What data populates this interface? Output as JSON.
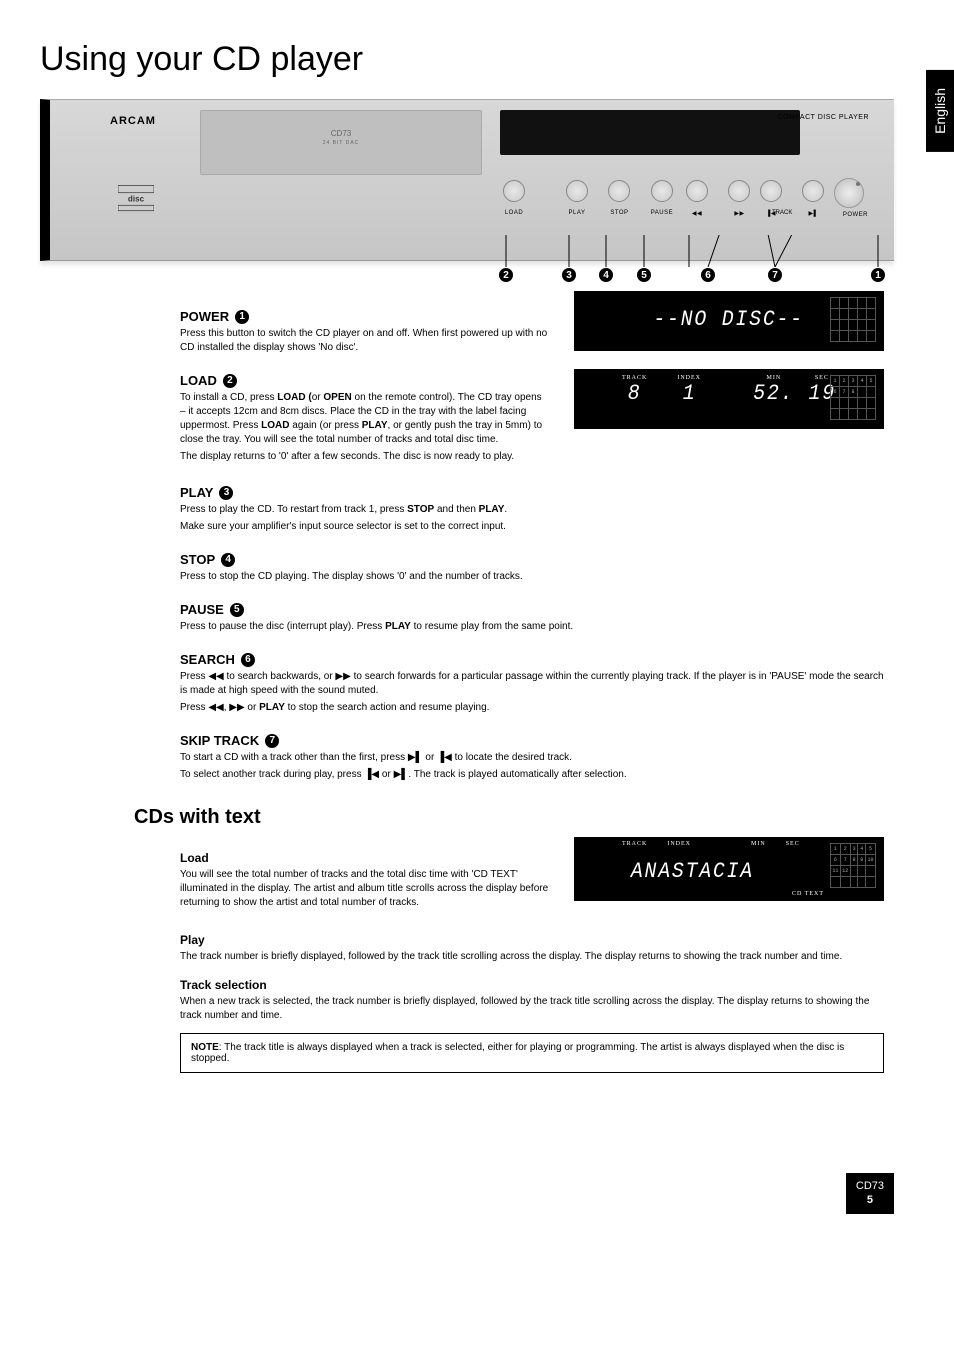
{
  "lang_tab": "English",
  "page_title": "Using your CD player",
  "device": {
    "brand": "ARCAM",
    "tray_model": "CD73",
    "tray_sub": "24 BIT DAC",
    "right_label": "COMPACT DISC PLAYER",
    "buttons": {
      "load": "LOAD",
      "play": "PLAY",
      "stop": "STOP",
      "pause": "PAUSE",
      "rew": "◀◀",
      "ff": "▶▶",
      "track_label": "TRACK",
      "prev": "▐◀",
      "next": "▶▌",
      "power": "POWER"
    },
    "callouts": [
      "1",
      "2",
      "3",
      "4",
      "5",
      "6",
      "7"
    ]
  },
  "sections": {
    "power": {
      "title": "POWER",
      "num": "1",
      "p1": "Press this button to switch the CD player on and off. When first powered up with no CD installed the display shows 'No disc'."
    },
    "load": {
      "title": "LOAD",
      "num": "2",
      "p1_pre": "To install a CD, press ",
      "p1_b1": "LOAD (",
      "p1_mid": "or ",
      "p1_b2": "OPEN",
      "p1_post": " on the remote control). The CD tray opens – it accepts 12cm and 8cm discs. Place the CD in the tray with the label facing uppermost. Press ",
      "p1_b3": "LOAD",
      "p1_post2": " again (or press ",
      "p1_b4": "PLAY",
      "p1_post3": ", or gently push the tray in 5mm) to close the tray. You will see the total number of tracks and total disc time.",
      "p2": "The display returns to '0' after a few seconds. The disc is now ready to play."
    },
    "play": {
      "title": "PLAY",
      "num": "3",
      "p1_pre": "Press to play the CD. To restart from track 1, press ",
      "p1_b1": "STOP",
      "p1_mid": " and then ",
      "p1_b2": "PLAY",
      "p1_post": ".",
      "p2": "Make sure your amplifier's input source selector is set to the correct input."
    },
    "stop": {
      "title": "STOP",
      "num": "4",
      "p1": "Press to stop the CD playing. The display shows '0' and the number of tracks."
    },
    "pause": {
      "title": "PAUSE",
      "num": "5",
      "p1_pre": "Press to pause the disc (interrupt play). Press ",
      "p1_b1": "PLAY",
      "p1_post": " to resume play from the same point."
    },
    "search": {
      "title": "SEARCH",
      "num": "6",
      "p1": "Press ◀◀ to search backwards, or ▶▶ to search forwards for a particular passage within the currently playing track. If the player is in 'PAUSE' mode the search is made at high speed with the sound muted.",
      "p2_pre": "Press ◀◀, ▶▶ or ",
      "p2_b1": "PLAY",
      "p2_post": " to stop the search action and resume playing."
    },
    "skip": {
      "title": "SKIP TRACK",
      "num": "7",
      "p1": "To start a CD with a track other than the first, press ▶▌ or ▐◀ to locate the desired track.",
      "p2": "To select another track during play, press ▐◀ or ▶▌. The track is played automatically after selection."
    }
  },
  "lcd1": {
    "text": "--NO DISC--"
  },
  "lcd2": {
    "track_lbl": "TRACK",
    "index_lbl": "INDEX",
    "min_lbl": "MIN",
    "sec_lbl": "SEC",
    "track": "8",
    "index": "1",
    "min": "52.",
    "sec": "19"
  },
  "cds_text": {
    "heading": "CDs with text",
    "load": {
      "h": "Load",
      "p": "You will see the total number of tracks and the total disc time with 'CD TEXT' illuminated in the display. The artist and album title scrolls across the display before returning to show the artist and total number of tracks."
    },
    "play": {
      "h": "Play",
      "p": "The track number is briefly displayed, followed by the track title scrolling across the display. The display returns to showing the track number and time."
    },
    "tracksel": {
      "h": "Track selection",
      "p": "When a new track is selected, the track number is briefly displayed, followed by the track title scrolling across the display. The display returns to showing the track number and time."
    },
    "note_b": "NOTE",
    "note": ": The track title is always displayed when a track is selected, either for playing or programming. The artist is always displayed when the disc is stopped."
  },
  "lcd3": {
    "track_lbl": "TRACK",
    "index_lbl": "INDEX",
    "min_lbl": "MIN",
    "sec_lbl": "SEC",
    "main": "ANASTACIA",
    "cdtext": "CD TEXT",
    "grid_nums": [
      "1",
      "2",
      "3",
      "4",
      "5",
      "6",
      "7",
      "8",
      "9",
      "10",
      "11",
      "12"
    ]
  },
  "footer": {
    "model": "CD73",
    "page": "5"
  }
}
